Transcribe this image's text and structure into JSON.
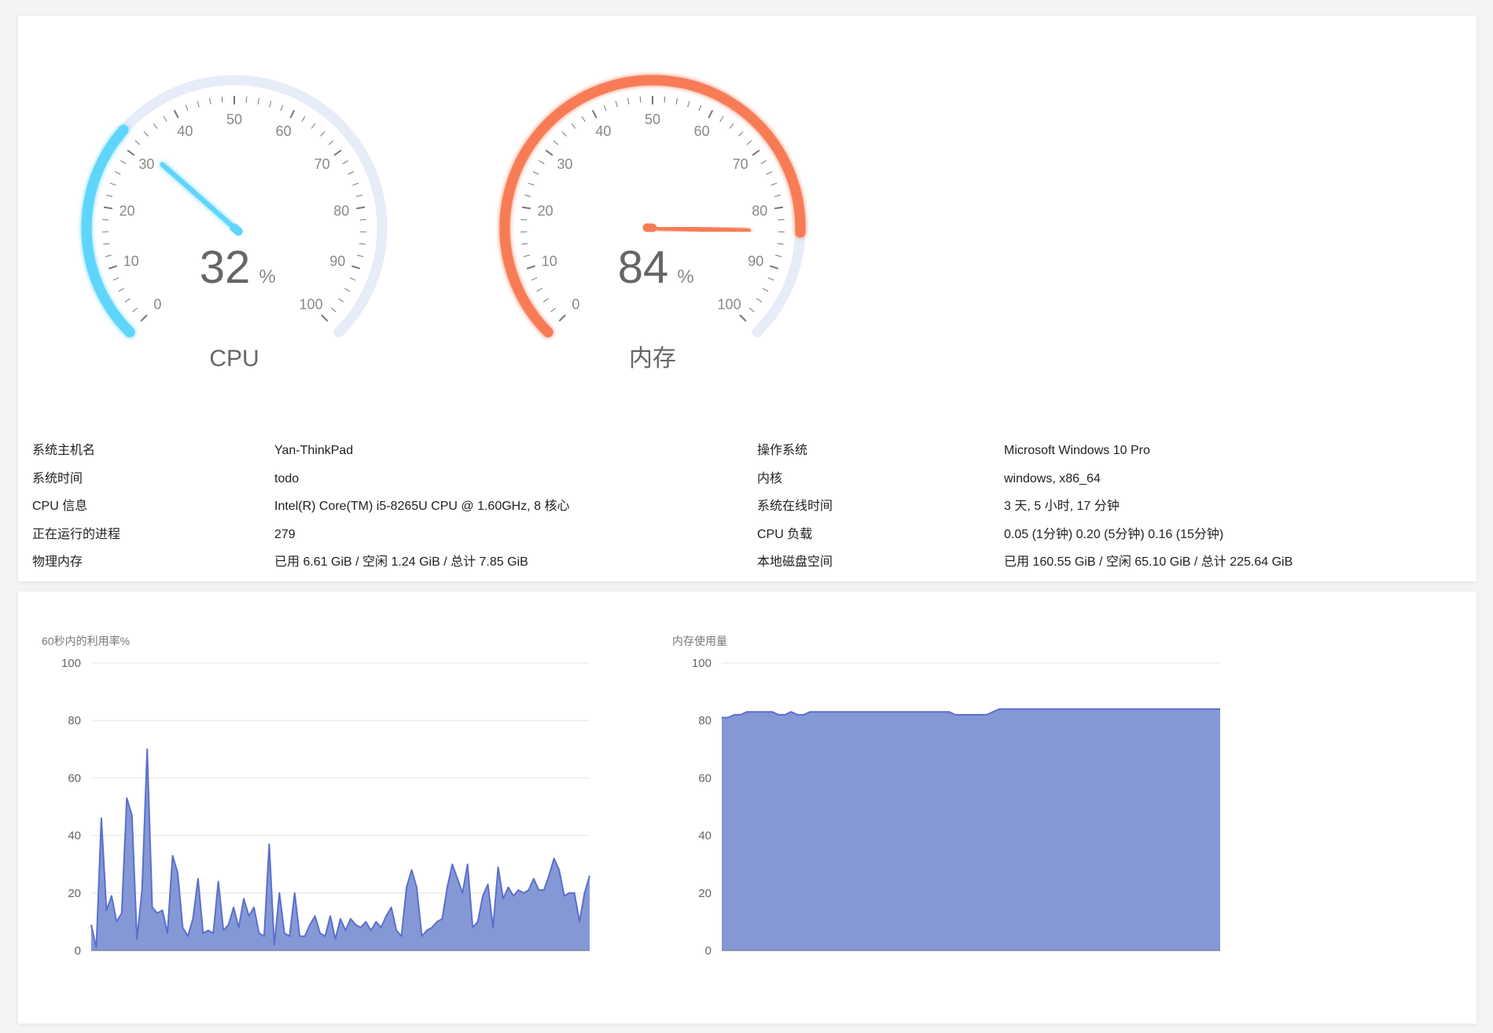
{
  "gauges": [
    {
      "id": "cpu",
      "label": "CPU",
      "value": 32,
      "unit": "%",
      "color": "#5fd5fb",
      "track": "#e6ecf8",
      "ticks": [
        "0",
        "10",
        "20",
        "30",
        "40",
        "50",
        "60",
        "70",
        "80",
        "90",
        "100"
      ]
    },
    {
      "id": "mem",
      "label": "内存",
      "value": 84,
      "unit": "%",
      "color": "#f77b56",
      "track": "#e6ecf8",
      "ticks": [
        "0",
        "10",
        "20",
        "30",
        "40",
        "50",
        "60",
        "70",
        "80",
        "90",
        "100"
      ]
    }
  ],
  "system_info": [
    {
      "label": "系统主机名",
      "value": "Yan-ThinkPad",
      "label2": "操作系统",
      "value2": "Microsoft Windows 10 Pro"
    },
    {
      "label": "系统时间",
      "value": "todo",
      "label2": "内核",
      "value2": "windows, x86_64"
    },
    {
      "label": "CPU 信息",
      "value": "Intel(R) Core(TM) i5-8265U CPU @ 1.60GHz, 8 核心",
      "label2": "系统在线时间",
      "value2": "3 天, 5 小时, 17 分钟"
    },
    {
      "label": "正在运行的进程",
      "value": "279",
      "label2": "CPU 负载",
      "value2": "0.05 (1分钟) 0.20 (5分钟) 0.16 (15分钟)"
    },
    {
      "label": "物理内存",
      "value": "已用 6.61 GiB / 空闲 1.24 GiB / 总计 7.85 GiB",
      "label2": "本地磁盘空间",
      "value2": "已用 160.55 GiB / 空闲 65.10 GiB / 总计 225.64 GiB"
    }
  ],
  "chart_data": [
    {
      "type": "area",
      "title": "60秒内的利用率%",
      "ylim": [
        0,
        100
      ],
      "yticks": [
        "0",
        "20",
        "40",
        "60",
        "80",
        "100"
      ],
      "grid": true,
      "color": "#5b6fcc",
      "fill": "#8598d6",
      "y": [
        9,
        1,
        46,
        14,
        19,
        10,
        13,
        53,
        47,
        4,
        21,
        70,
        15,
        13,
        14,
        6,
        33,
        27,
        8,
        5,
        11,
        25,
        6,
        7,
        6,
        24,
        7,
        9,
        15,
        8,
        18,
        12,
        15,
        6,
        5,
        37,
        2,
        20,
        6,
        5,
        20,
        5,
        5,
        9,
        12,
        6,
        5,
        12,
        4,
        11,
        7,
        11,
        9,
        8,
        10,
        7,
        10,
        8,
        12,
        15,
        7,
        5,
        22,
        28,
        22,
        5,
        7,
        8,
        10,
        11,
        22,
        30,
        25,
        20,
        30,
        8,
        10,
        19,
        23,
        8,
        29,
        18,
        22,
        19,
        21,
        20,
        21,
        25,
        21,
        21,
        26,
        32,
        28,
        19,
        20,
        20,
        10,
        20,
        26
      ]
    },
    {
      "type": "area",
      "title": "内存使用量",
      "ylim": [
        0,
        100
      ],
      "yticks": [
        "0",
        "20",
        "40",
        "60",
        "80",
        "100"
      ],
      "grid": true,
      "color": "#5b6fcc",
      "fill": "#8598d6",
      "y": [
        81,
        81,
        82,
        82,
        83,
        83,
        83,
        83,
        83,
        82,
        82,
        83,
        82,
        82,
        83,
        83,
        83,
        83,
        83,
        83,
        83,
        83,
        83,
        83,
        83,
        83,
        83,
        83,
        83,
        83,
        83,
        83,
        83,
        83,
        83,
        83,
        83,
        82,
        82,
        82,
        82,
        82,
        82,
        83,
        84,
        84,
        84,
        84,
        84,
        84,
        84,
        84,
        84,
        84,
        84,
        84,
        84,
        84,
        84,
        84,
        84,
        84,
        84,
        84,
        84,
        84,
        84,
        84,
        84,
        84,
        84,
        84,
        84,
        84,
        84,
        84,
        84,
        84,
        84,
        84
      ]
    }
  ]
}
